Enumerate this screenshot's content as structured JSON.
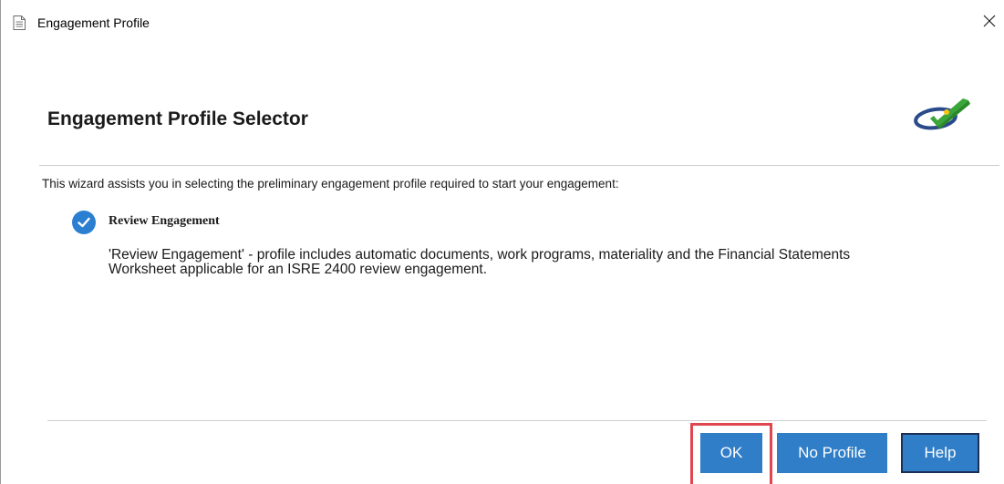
{
  "window": {
    "title": "Engagement Profile",
    "close_label": "×"
  },
  "header": {
    "title": "Engagement Profile Selector",
    "logo": "checkmark-swoosh-logo"
  },
  "intro": "This wizard assists you in selecting the preliminary engagement profile required to start your engagement:",
  "option": {
    "label": "Review Engagement",
    "selected": true,
    "icon": "check-circle-icon",
    "description_line1": "'Review Engagement' - profile includes automatic documents, work programs, materiality and the Financial Statements",
    "description_line2": "Worksheet applicable for an ISRE 2400 review engagement."
  },
  "buttons": {
    "ok": "OK",
    "no_profile": "No Profile",
    "help": "Help"
  },
  "colors": {
    "button_blue": "#2f7ec7",
    "check_blue": "#2b7fd0",
    "highlight_red": "#e0464f",
    "help_border": "#1b2f57"
  }
}
